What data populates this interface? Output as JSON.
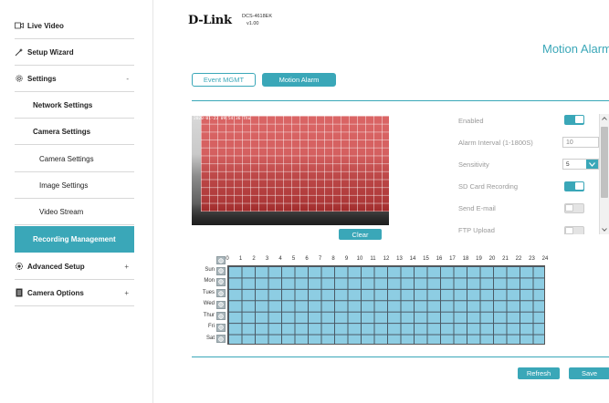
{
  "sidebar": {
    "live_video": "Live Video",
    "setup_wizard": "Setup Wizard",
    "settings": "Settings",
    "settings_expander": "-",
    "network_settings": "Network Settings",
    "camera_settings": "Camera Settings",
    "camera_settings_sub": "Camera Settings",
    "image_settings": "Image Settings",
    "video_stream": "Video Stream",
    "recording_management": "Recording Management",
    "advanced_setup": "Advanced Setup",
    "advanced_expander": "+",
    "camera_options": "Camera Options",
    "camera_options_expander": "+"
  },
  "header": {
    "brand": "D-Link",
    "model": "DCS-4618EK",
    "version": "v1.00",
    "page_title": "Motion Alarm"
  },
  "tabs": {
    "event_mgmt": "Event MGMT",
    "motion_alarm": "Motion Alarm"
  },
  "camera": {
    "timestamp": "2020-01-23 09:54:36 Thu"
  },
  "clear_label": "Clear",
  "settings": {
    "enabled_label": "Enabled",
    "enabled_value": true,
    "interval_label": "Alarm Interval (1-1800S)",
    "interval_value": "10",
    "sensitivity_label": "Sensitivity",
    "sensitivity_value": "5",
    "sd_card_label": "SD Card Recording",
    "sd_card_value": true,
    "send_email_label": "Send E-mail",
    "send_email_value": false,
    "ftp_upload_label": "FTP Upload",
    "ftp_upload_value": false
  },
  "schedule": {
    "hours": [
      "0",
      "1",
      "2",
      "3",
      "4",
      "5",
      "6",
      "7",
      "8",
      "9",
      "10",
      "11",
      "12",
      "13",
      "14",
      "15",
      "16",
      "17",
      "18",
      "19",
      "20",
      "21",
      "22",
      "23",
      "24"
    ],
    "days": [
      "Sun",
      "Mon",
      "Tues",
      "Wed",
      "Thur",
      "Fri",
      "Sat"
    ],
    "select_icon": "select-all-icon",
    "selected_fraction": 1.0
  },
  "buttons": {
    "refresh": "Refresh",
    "save": "Save"
  },
  "colors": {
    "accent": "#3aa7b8",
    "motion_region": "#dc1e1e",
    "schedule_fill": "#8dcde3"
  }
}
